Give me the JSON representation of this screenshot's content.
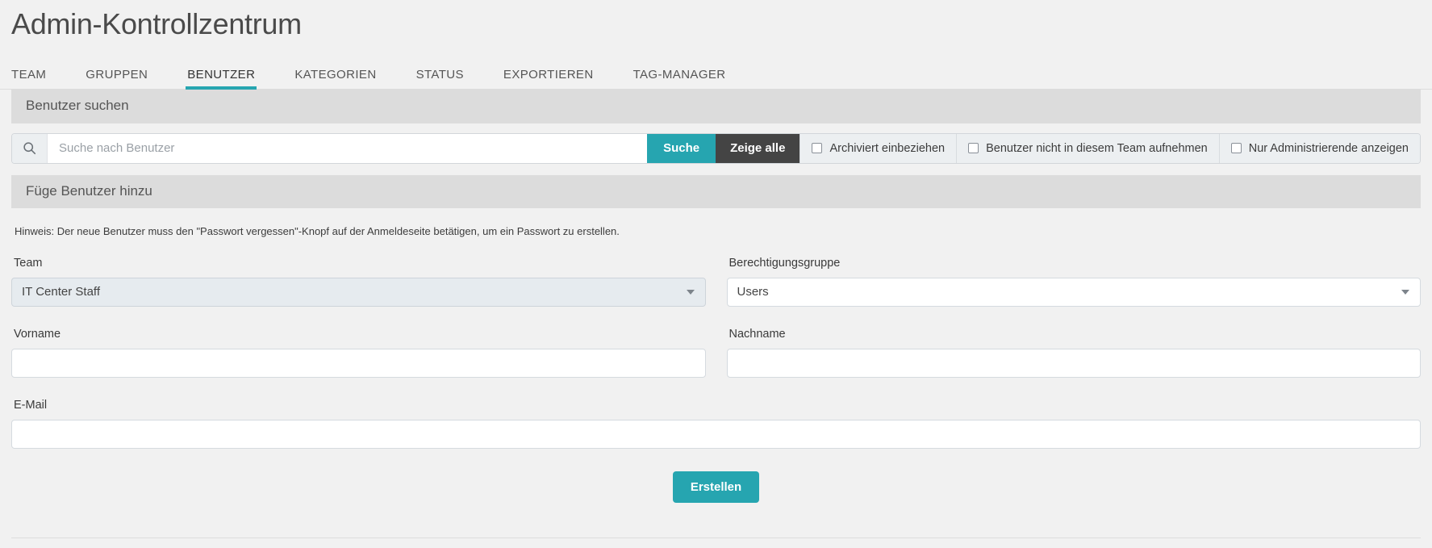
{
  "header": {
    "title": "Admin-Kontrollzentrum"
  },
  "tabs": [
    {
      "label": "TEAM",
      "active": false
    },
    {
      "label": "GRUPPEN",
      "active": false
    },
    {
      "label": "BENUTZER",
      "active": true
    },
    {
      "label": "KATEGORIEN",
      "active": false
    },
    {
      "label": "STATUS",
      "active": false
    },
    {
      "label": "EXPORTIEREN",
      "active": false
    },
    {
      "label": "TAG-MANAGER",
      "active": false
    }
  ],
  "search_panel": {
    "heading": "Benutzer suchen",
    "search_icon": "search-icon",
    "input_value": "",
    "input_placeholder": "Suche nach Benutzer",
    "search_button": "Suche",
    "show_all_button": "Zeige alle",
    "checkboxes": [
      {
        "label": "Archiviert einbeziehen",
        "checked": false
      },
      {
        "label": "Benutzer nicht in diesem Team aufnehmen",
        "checked": false
      },
      {
        "label": "Nur Administrierende anzeigen",
        "checked": false
      }
    ]
  },
  "add_user_panel": {
    "heading": "Füge Benutzer hinzu",
    "hint": "Hinweis: Der neue Benutzer muss den \"Passwort vergessen\"-Knopf auf der Anmeldeseite betätigen, um ein Passwort zu erstellen.",
    "fields": {
      "team_label": "Team",
      "team_value": "IT Center Staff",
      "permission_group_label": "Berechtigungsgruppe",
      "permission_group_value": "Users",
      "first_name_label": "Vorname",
      "first_name_value": "",
      "last_name_label": "Nachname",
      "last_name_value": "",
      "email_label": "E-Mail",
      "email_value": ""
    },
    "create_button": "Erstellen"
  },
  "colors": {
    "accent_teal": "#26a5b0",
    "dark_button": "#444444",
    "panel_head": "#dcdcdc",
    "page_bg": "#f1f1f1"
  }
}
